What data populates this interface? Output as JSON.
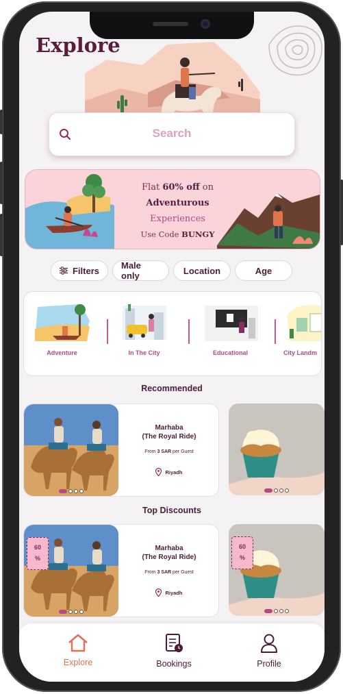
{
  "page": {
    "title": "Explore"
  },
  "search": {
    "placeholder": "Search"
  },
  "promo": {
    "line1_pre": "Flat ",
    "line1_bold": "60% off",
    "line1_post": " on",
    "line2": "Adventurous",
    "line3": "Experiences",
    "line4_pre": "Use Code ",
    "line4_code": "BUNGY"
  },
  "filters": [
    {
      "label": "Filters"
    },
    {
      "label": "Male only"
    },
    {
      "label": "Location"
    },
    {
      "label": "Age"
    }
  ],
  "categories": [
    {
      "label": "Adventure"
    },
    {
      "label": "In The City"
    },
    {
      "label": "Educational"
    },
    {
      "label": "City Landm"
    }
  ],
  "recommended": {
    "title": "Recommended",
    "card": {
      "name_line1": "Marhaba",
      "name_line2": "(The Royal Ride)",
      "price_pre": "From ",
      "price_value": "3 SAR",
      "price_post": " per Guest",
      "location": "Riyadh"
    }
  },
  "discounts": {
    "title": "Top Discounts",
    "card": {
      "name_line1": "Marhaba",
      "name_line2": "(The Royal Ride)",
      "price_pre": "From ",
      "price_value": "3 SAR",
      "price_post": " per Guest",
      "location": "Riyadh",
      "tag_value": "60",
      "tag_symbol": "%"
    },
    "card2_tag_value": "60",
    "card2_tag_symbol": "%"
  },
  "tabs": [
    {
      "label": "Explore",
      "icon": "home-icon",
      "active": true
    },
    {
      "label": "Bookings",
      "icon": "bookings-icon",
      "active": false
    },
    {
      "label": "Profile",
      "icon": "profile-icon",
      "active": false
    }
  ],
  "colors": {
    "brand": "#5a1c3c",
    "accent": "#b24a83",
    "active_tab": "#e07253",
    "promo_bg": "#fbd4da"
  }
}
